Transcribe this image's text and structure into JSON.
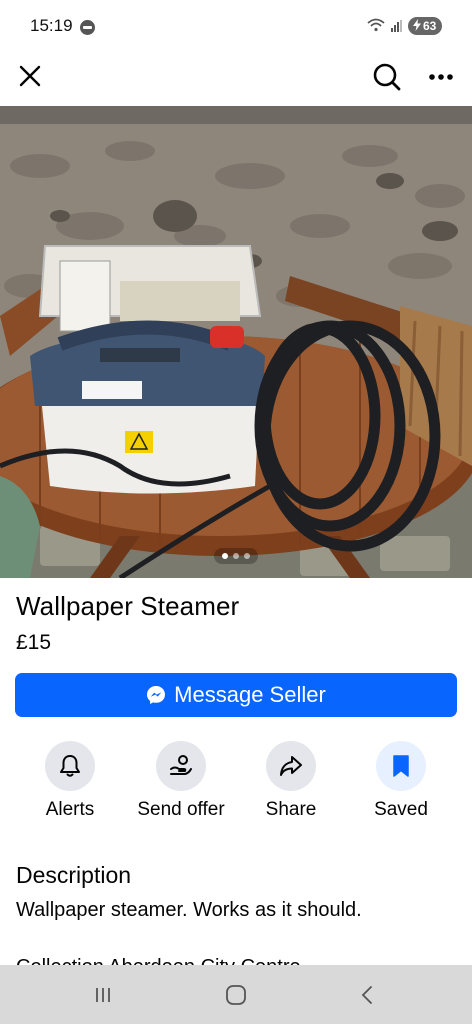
{
  "status_bar": {
    "time": "15:19",
    "battery": "63"
  },
  "icons": {
    "close": "close-icon",
    "search": "search-icon",
    "more": "more-horizontal-icon",
    "messenger": "messenger-icon",
    "alerts": "bell-icon",
    "send_offer": "hand-coin-icon",
    "share": "share-arrow-icon",
    "saved": "bookmark-icon"
  },
  "listing": {
    "title": "Wallpaper Steamer",
    "price": "£15",
    "photo_index": 1,
    "photo_count": 3
  },
  "message_button": {
    "label": "Message Seller"
  },
  "actions": [
    {
      "label": "Alerts"
    },
    {
      "label": "Send offer"
    },
    {
      "label": "Share"
    },
    {
      "label": "Saved"
    }
  ],
  "description": {
    "heading": "Description",
    "text": "Wallpaper steamer.  Works as it should.",
    "next_line_partial": "Collection Aberdeen City Centre"
  },
  "colors": {
    "accent": "#0866ff",
    "saved_icon": "#0866ff",
    "icon_gray": "#050505",
    "nav_bar": "#d9d9d9"
  }
}
